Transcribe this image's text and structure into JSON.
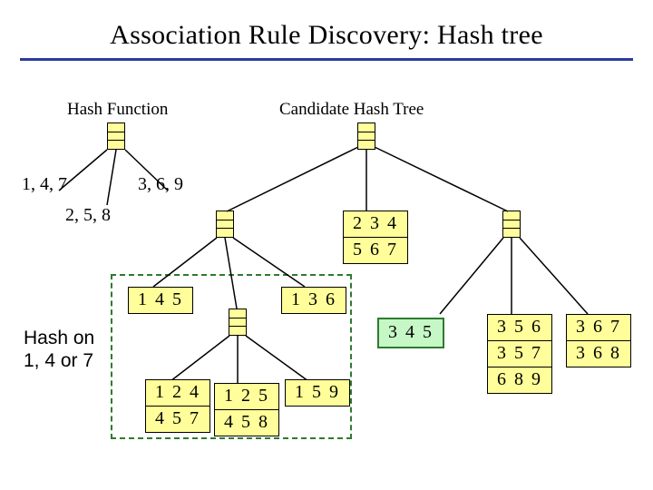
{
  "title": "Association Rule Discovery: Hash tree",
  "labels": {
    "hash_function": "Hash Function",
    "candidate_tree": "Candidate Hash Tree",
    "branch_left": "1, 4, 7",
    "branch_mid": "2, 5, 8",
    "branch_right": "3, 6, 9",
    "hash_on_l1": "Hash on",
    "hash_on_l2": "1, 4 or 7"
  },
  "leaf_234": {
    "r0": "2 3 4",
    "r1": "5 6 7"
  },
  "leaf_145": {
    "r0": "1 4 5"
  },
  "leaf_136": {
    "r0": "1 3 6"
  },
  "leaf_124": {
    "r0": "1 2 4",
    "r1": "4 5 7"
  },
  "leaf_125": {
    "r0": "1 2 5",
    "r1": "4 5 8"
  },
  "leaf_159": {
    "r0": "1 5 9"
  },
  "leaf_345": {
    "r0": "3 4 5"
  },
  "leaf_356": {
    "r0": "3 5 6",
    "r1": "3 5 7",
    "r2": "6 8 9"
  },
  "leaf_367": {
    "r0": "3 6 7",
    "r1": "3 6 8"
  }
}
